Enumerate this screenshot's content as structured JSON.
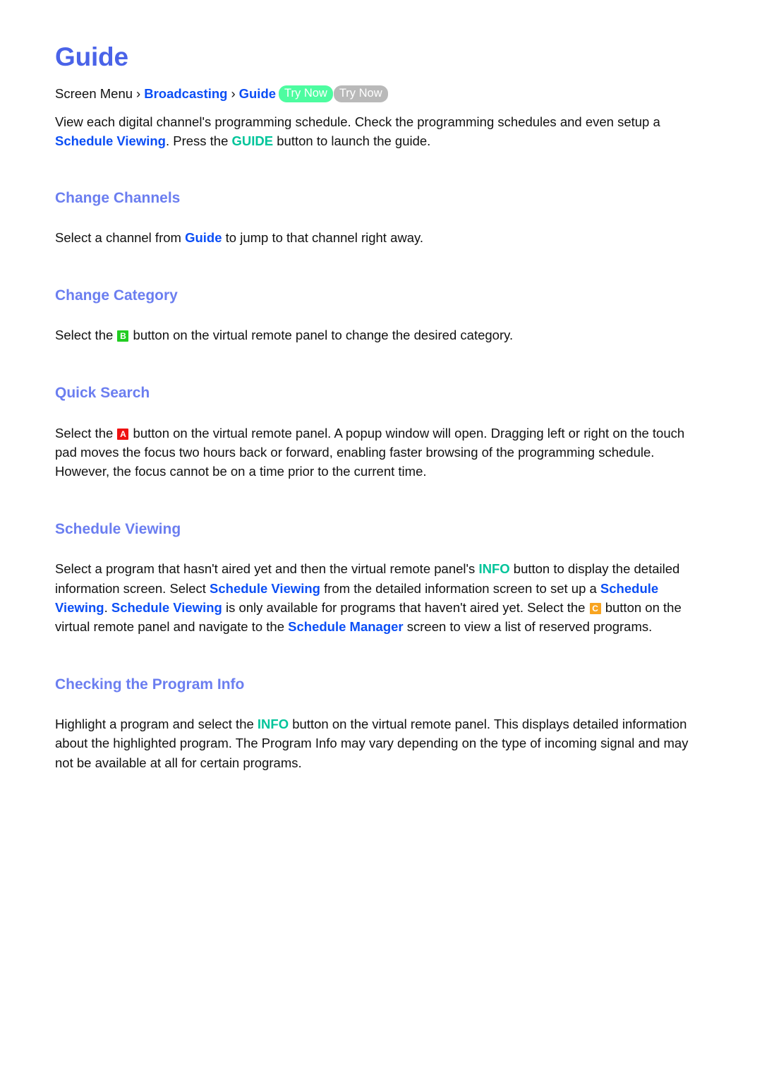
{
  "page": {
    "title": "Guide"
  },
  "breadcrumb": {
    "root_label": "Screen Menu",
    "separator": "›",
    "item1_label": "Broadcasting",
    "item2_label": "Guide",
    "badge_primary": "Try Now",
    "badge_secondary": "Try Now"
  },
  "intro": {
    "part1": "View each digital channel's programming schedule. Check the programming schedules and even setup a ",
    "link1": "Schedule Viewing",
    "part2": ". Press the ",
    "keyword1": "GUIDE",
    "part3": " button to launch the guide."
  },
  "sections": [
    {
      "heading": "Change Channels",
      "body": {
        "part1": "Select a channel from ",
        "link1": "Guide",
        "part2": " to jump to that channel right away."
      }
    },
    {
      "heading": "Change Category",
      "body": {
        "part1": "Select the ",
        "button": "B",
        "part2": " button on the virtual remote panel to change the desired category."
      }
    },
    {
      "heading": "Quick Search",
      "body": {
        "part1": "Select the ",
        "button": "A",
        "part2": " button on the virtual remote panel. A popup window will open. Dragging left or right on the touch pad moves the focus two hours back or forward, enabling faster browsing of the programming schedule. However, the focus cannot be on a time prior to the current time."
      }
    },
    {
      "heading": "Schedule Viewing",
      "body": {
        "part1": "Select a program that hasn't aired yet and then the virtual remote panel's ",
        "keyword1": "INFO",
        "part2": " button to display the detailed information screen. Select ",
        "link1": "Schedule Viewing",
        "part3": " from the detailed information screen to set up a ",
        "link2": "Schedule Viewing",
        "part4": ". ",
        "link3": "Schedule Viewing",
        "part5": " is only available for programs that haven't aired yet. Select the ",
        "button": "C",
        "part6": " button on the virtual remote panel and navigate to the ",
        "link4": "Schedule Manager",
        "part7": " screen to view a list of reserved programs."
      }
    },
    {
      "heading": "Checking the Program Info",
      "body": {
        "part1": "Highlight a program and select the ",
        "keyword1": "INFO",
        "part2": " button on the virtual remote panel. This displays detailed information about the highlighted program. The Program Info may vary depending on the type of incoming signal and may not be available at all for certain programs."
      }
    }
  ],
  "colors": {
    "title_blue": "#4a63e8",
    "heading_blue": "#6b7ef0",
    "link_blue": "#0b4ef5",
    "teal": "#00c49a",
    "badge_green": "#4dfca0",
    "badge_gray": "#b9b9b9",
    "button_a_red": "#ee1111",
    "button_b_green": "#22cc22",
    "button_c_orange": "#f8a420"
  }
}
